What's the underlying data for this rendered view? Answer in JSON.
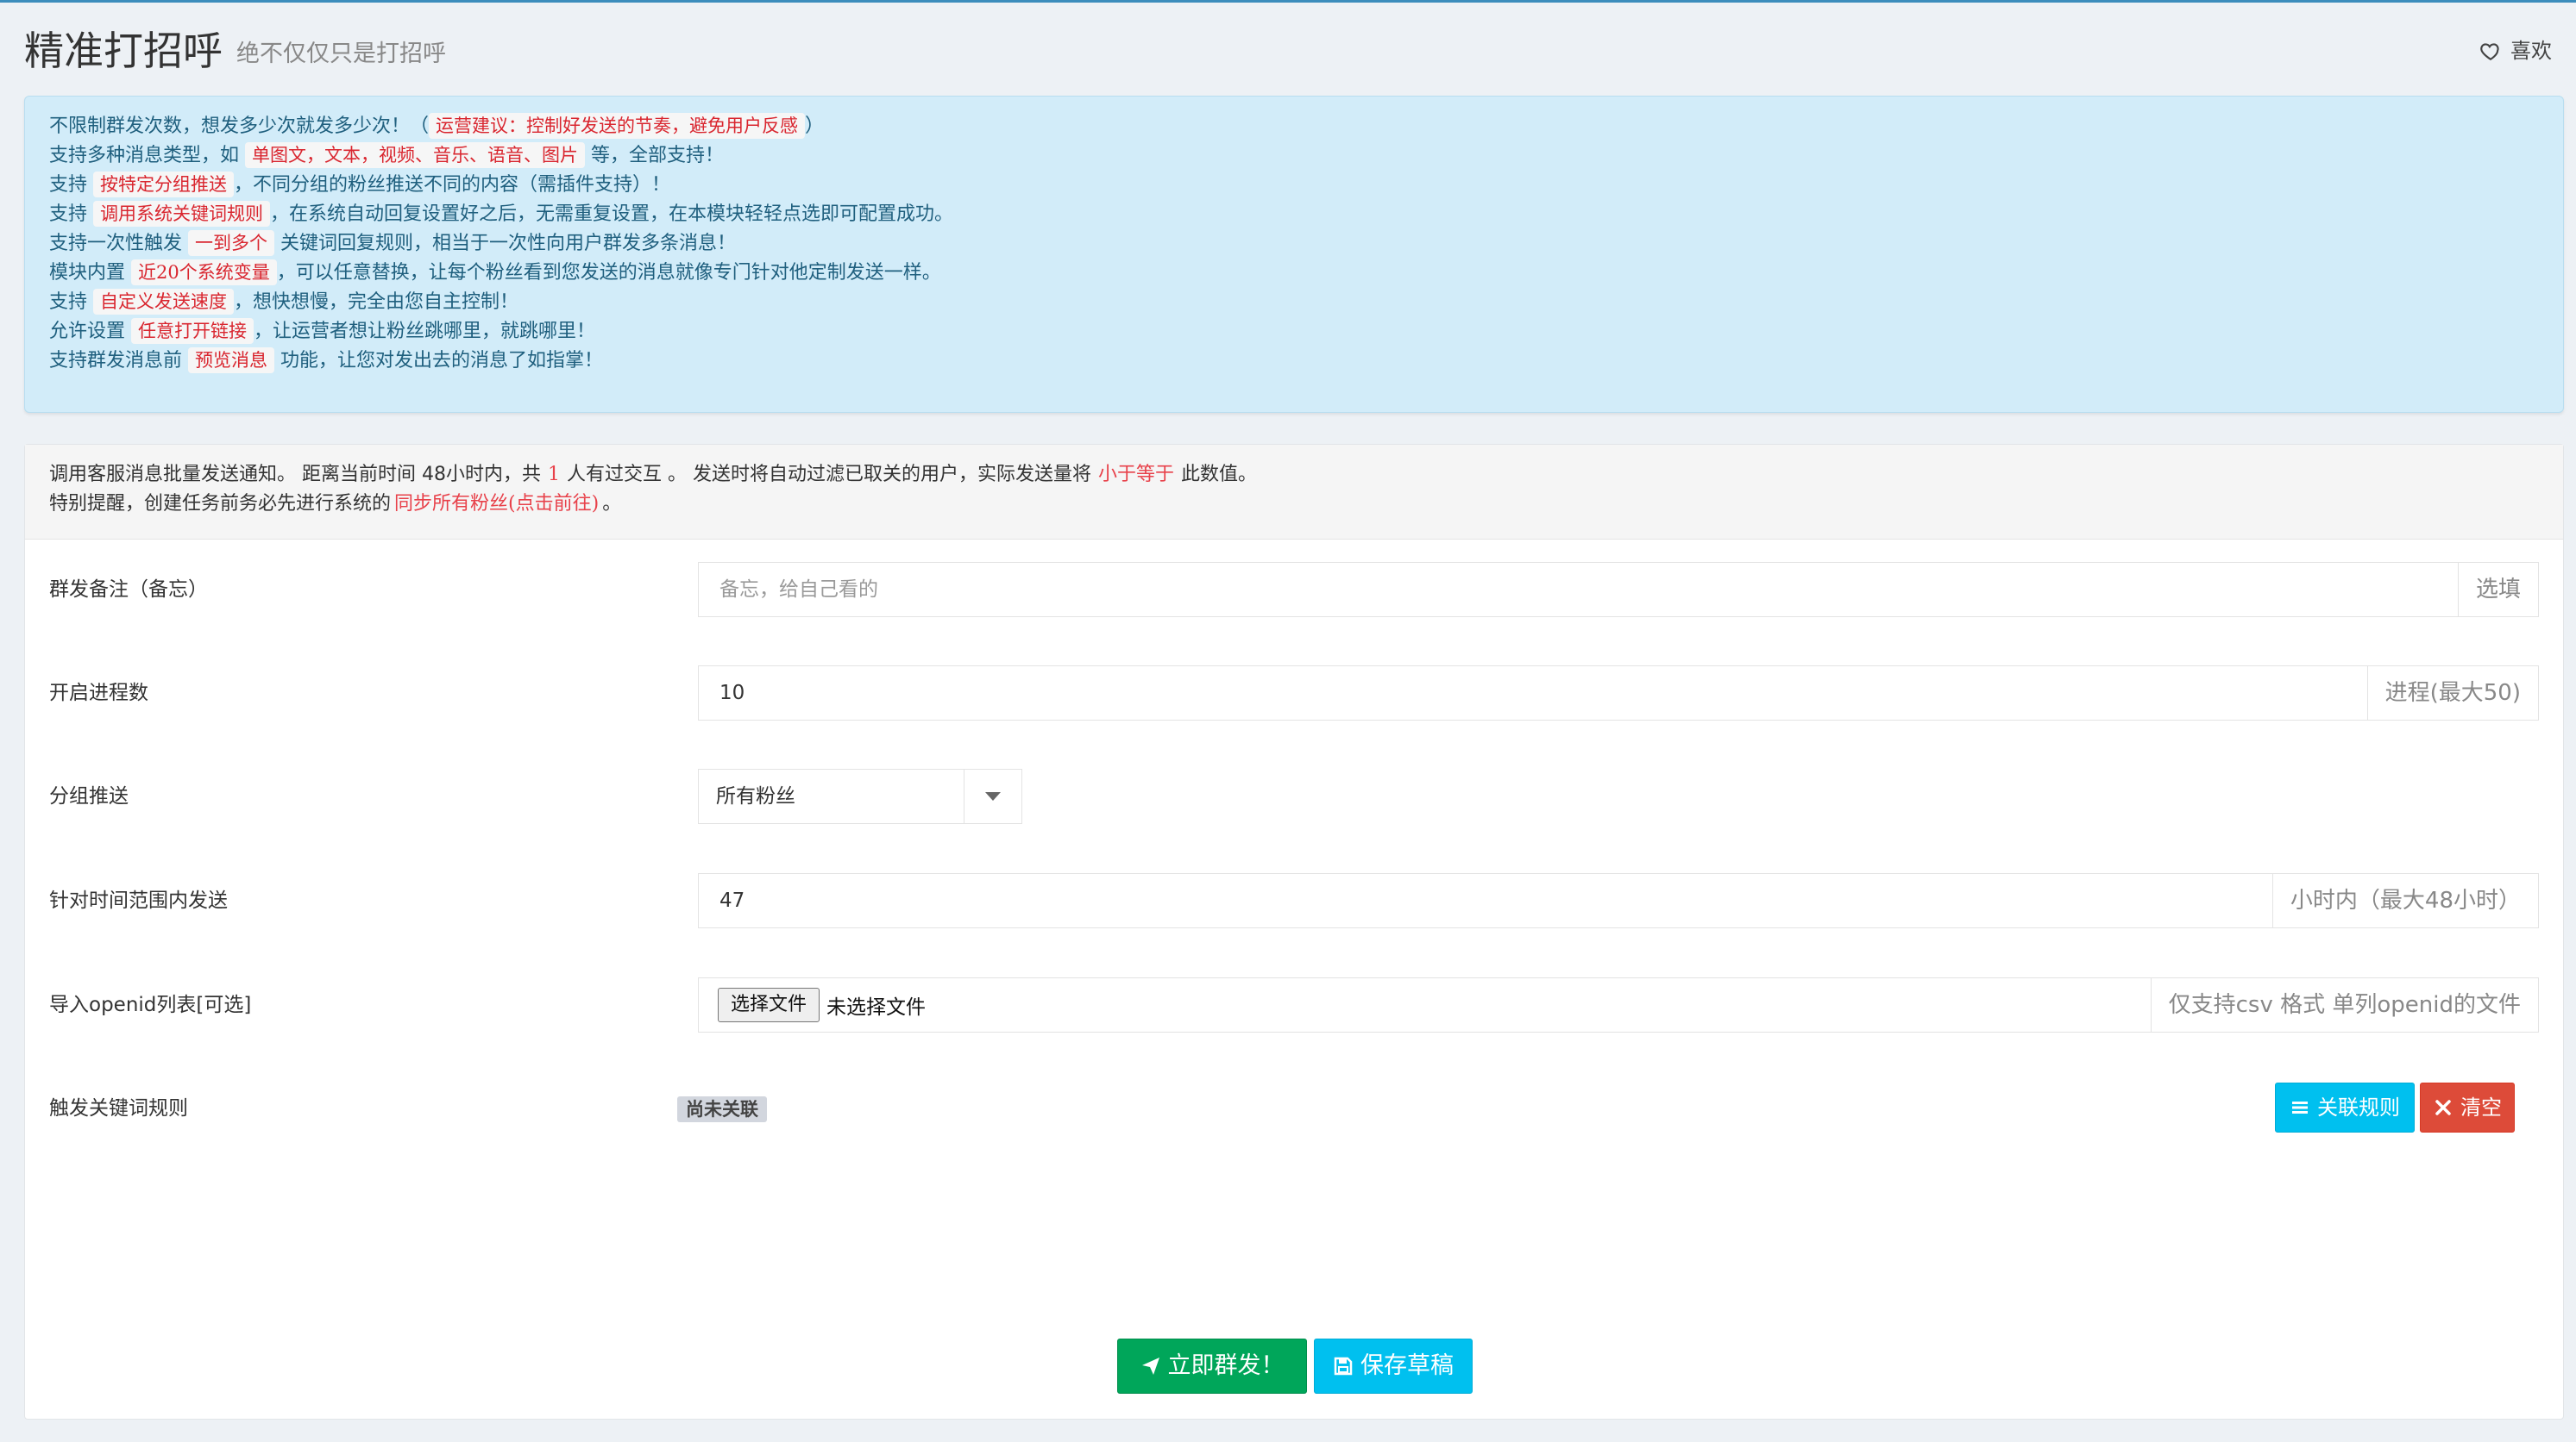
{
  "header": {
    "title": "精准打招呼",
    "subtitle": "绝不仅仅只是打招呼",
    "like_label": "喜欢"
  },
  "notice": {
    "lines": [
      {
        "a": "不限制群发次数，想发多少次就发多少次！（",
        "hl": "运营建议：控制好发送的节奏，避免用户反感",
        "b": "）"
      },
      {
        "a": "支持多种消息类型，如 ",
        "hl": "单图文，文本，视频、音乐、语音、图片",
        "b": " 等，全部支持！"
      },
      {
        "a": "支持 ",
        "hl": "按特定分组推送",
        "b": "，不同分组的粉丝推送不同的内容（需插件支持）！"
      },
      {
        "a": "支持 ",
        "hl": "调用系统关键词规则",
        "b": "，在系统自动回复设置好之后，无需重复设置，在本模块轻轻点选即可配置成功。"
      },
      {
        "a": "支持一次性触发 ",
        "hl": "一到多个",
        "b": " 关键词回复规则，相当于一次性向用户群发多条消息！"
      },
      {
        "a": "模块内置 ",
        "hl": "近20个系统变量",
        "b": "，可以任意替换，让每个粉丝看到您发送的消息就像专门针对他定制发送一样。"
      },
      {
        "a": "支持 ",
        "hl": "自定义发送速度",
        "b": "，想快想慢，完全由您自主控制！"
      },
      {
        "a": "允许设置 ",
        "hl": "任意打开链接",
        "b": "，让运营者想让粉丝跳哪里，就跳哪里！"
      },
      {
        "a": "支持群发消息前 ",
        "hl": "预览消息",
        "b": " 功能，让您对发出去的消息了如指掌！"
      }
    ]
  },
  "info": {
    "line1_a": "调用客服消息批量发送通知。 距离当前时间 48小时内，共",
    "count": "1",
    "line1_b": "人有过交互 。 发送时将自动过滤已取关的用户，实际发送量将",
    "lte": "小于等于",
    "line1_c": "此数值。",
    "line2_a": "特别提醒，创建任务前务必先进行系统的",
    "sync_link": "同步所有粉丝(点击前往)",
    "line2_b": "。"
  },
  "form": {
    "remark_label": "群发备注（备忘）",
    "remark_placeholder": "备忘，给自己看的",
    "remark_addon": "选填",
    "process_label": "开启进程数",
    "process_value": "10",
    "process_addon": "进程(最大50)",
    "group_label": "分组推送",
    "group_value": "所有粉丝",
    "time_label": "针对时间范围内发送",
    "time_value": "47",
    "time_addon": "小时内（最大48小时）",
    "openid_label": "导入openid列表[可选]",
    "file_button": "选择文件",
    "file_status": "未选择文件",
    "openid_addon": "仅支持csv 格式 单列openid的文件",
    "keyword_label": "触发关键词规则",
    "keyword_badge": "尚未关联",
    "link_rule_label": "关联规则",
    "clear_label": "清空"
  },
  "actions": {
    "send_label": "立即群发！",
    "save_label": "保存草稿"
  },
  "colors": {
    "primary_top": "#3c8dbc",
    "info": "#00c0ef",
    "danger": "#dd4b39",
    "success": "#00a65a",
    "highlight_text": "#d9262f"
  }
}
